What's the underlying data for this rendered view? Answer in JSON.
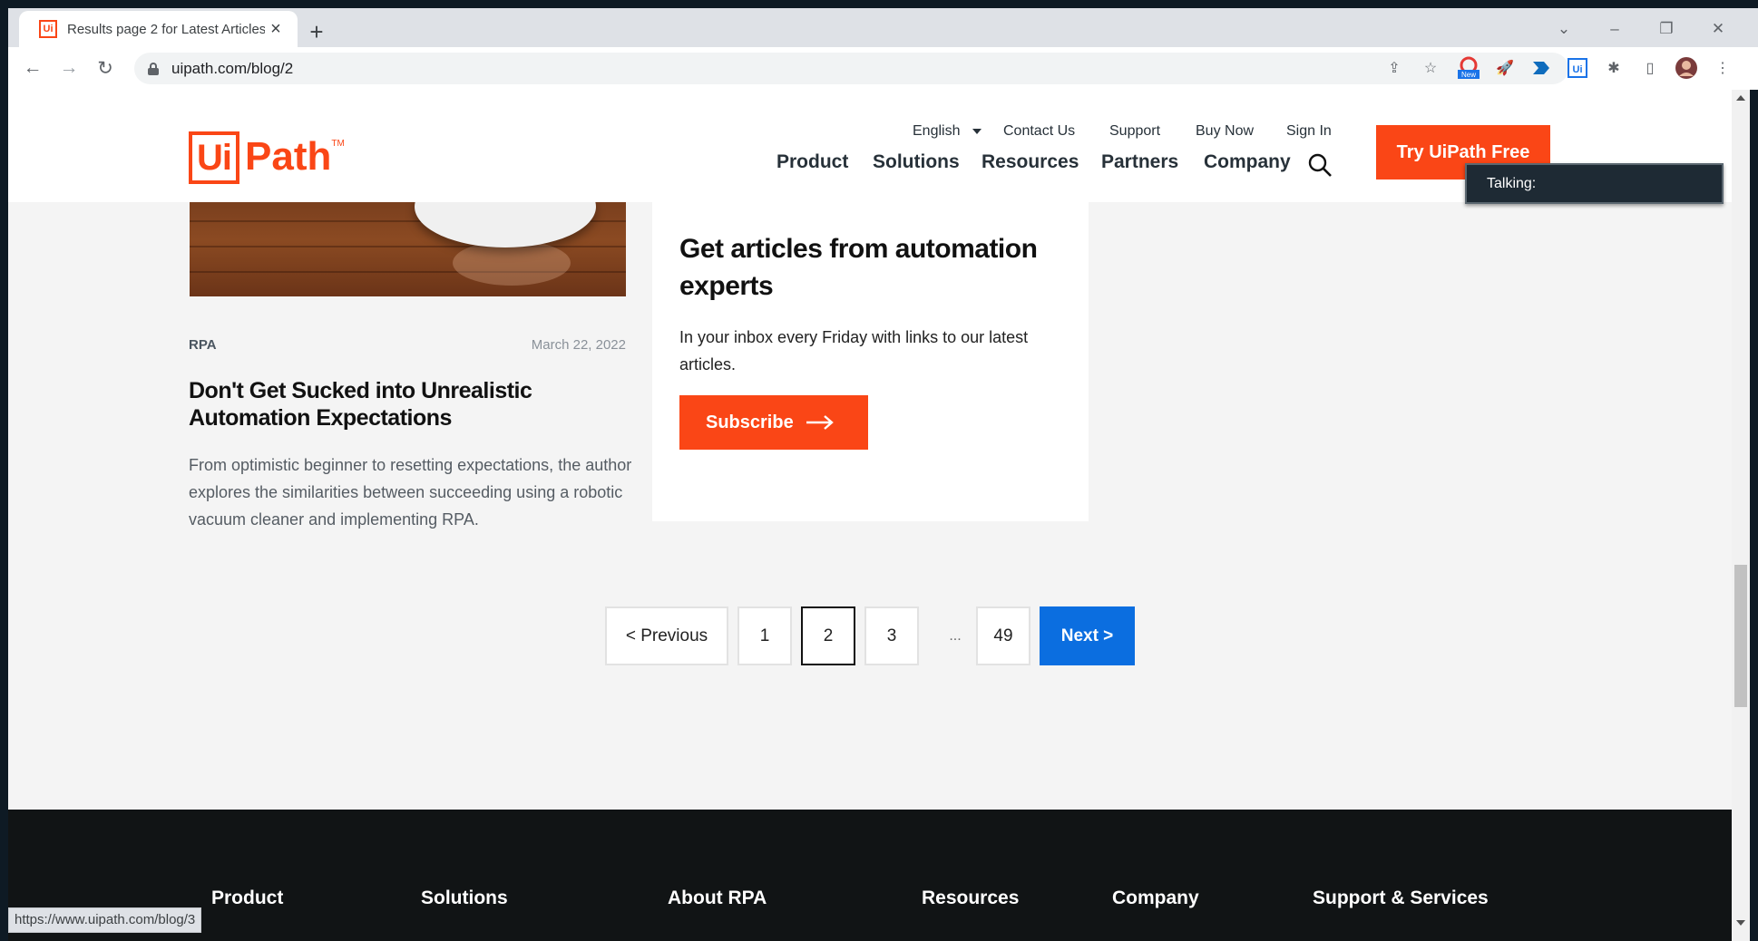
{
  "browser": {
    "tab_title": "Results page 2 for Latest Articles",
    "tab_favicon": "Ui",
    "url": "uipath.com/blog/2",
    "status_url": "https://www.uipath.com/blog/3",
    "extension_badge": "New"
  },
  "header": {
    "logo_box": "Ui",
    "logo_text": "Path",
    "logo_tm": "TM",
    "language": "English",
    "util_links": [
      "Contact Us",
      "Support",
      "Buy Now",
      "Sign In"
    ],
    "main_nav": [
      "Product",
      "Solutions",
      "Resources",
      "Partners",
      "Company"
    ],
    "cta": "Try UiPath Free"
  },
  "overlay": {
    "talking_label": "Talking:"
  },
  "article": {
    "category": "RPA",
    "date": "March 22, 2022",
    "title": "Don't Get Sucked into Unrealistic Automation Expectations",
    "description": "From optimistic beginner to resetting expectations, the author explores the similarities between succeeding using a robotic vacuum cleaner and implementing RPA."
  },
  "subscribe": {
    "title": "Get articles from automation experts",
    "text": "In your inbox every Friday with links to our latest articles.",
    "button": "Subscribe"
  },
  "pagination": {
    "previous": "<  Previous",
    "pages": [
      "1",
      "2",
      "3",
      "...",
      "49"
    ],
    "current": "2",
    "next": "Next  >"
  },
  "footer": {
    "headings": [
      "Product",
      "Solutions",
      "About RPA",
      "Resources",
      "Company",
      "Support & Services"
    ]
  },
  "colors": {
    "brand_orange": "#fa4616",
    "next_blue": "#0b6ee0",
    "footer_bg": "#111415"
  }
}
